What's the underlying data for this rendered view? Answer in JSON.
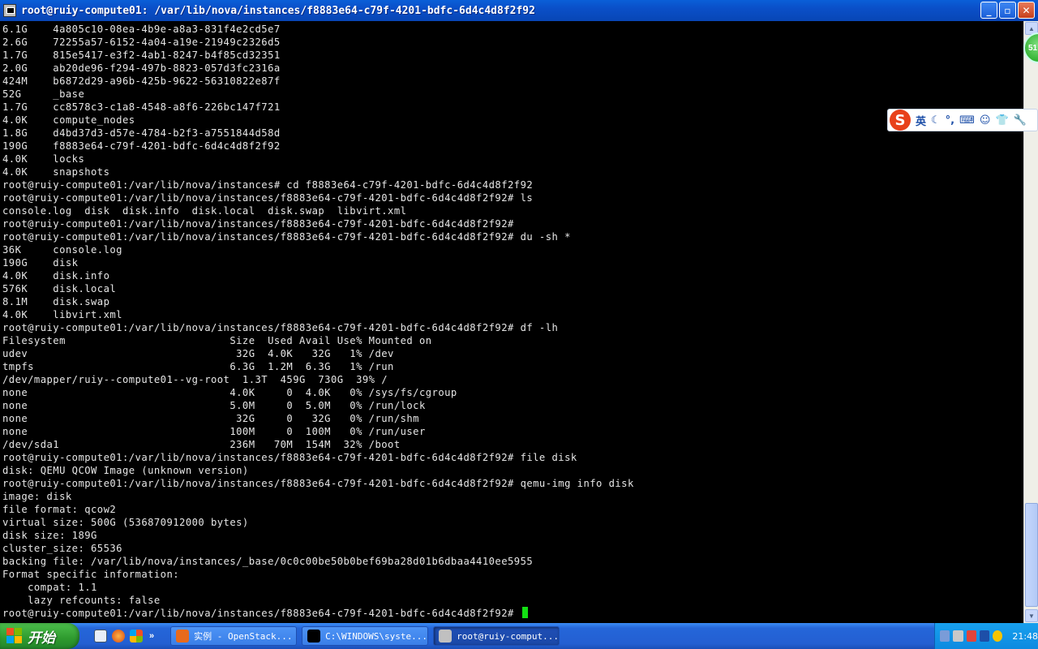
{
  "window": {
    "title": "root@ruiy-compute01: /var/lib/nova/instances/f8883e64-c79f-4201-bdfc-6d4c4d8f2f92",
    "minimize_glyph": "_",
    "maximize_glyph": "▫",
    "close_glyph": "✕"
  },
  "terminal": {
    "lines": [
      "6.1G    4a805c10-08ea-4b9e-a8a3-831f4e2cd5e7",
      "2.6G    72255a57-6152-4a04-a19e-21949c2326d5",
      "1.7G    815e5417-e3f2-4ab1-8247-b4f85cd32351",
      "2.0G    ab20de96-f294-497b-8823-057d3fc2316a",
      "424M    b6872d29-a96b-425b-9622-56310822e87f",
      "52G     _base",
      "1.7G    cc8578c3-c1a8-4548-a8f6-226bc147f721",
      "4.0K    compute_nodes",
      "1.8G    d4bd37d3-d57e-4784-b2f3-a7551844d58d",
      "190G    f8883e64-c79f-4201-bdfc-6d4c4d8f2f92",
      "4.0K    locks",
      "4.0K    snapshots",
      "root@ruiy-compute01:/var/lib/nova/instances# cd f8883e64-c79f-4201-bdfc-6d4c4d8f2f92",
      "root@ruiy-compute01:/var/lib/nova/instances/f8883e64-c79f-4201-bdfc-6d4c4d8f2f92# ls",
      "console.log  disk  disk.info  disk.local  disk.swap  libvirt.xml",
      "root@ruiy-compute01:/var/lib/nova/instances/f8883e64-c79f-4201-bdfc-6d4c4d8f2f92#",
      "root@ruiy-compute01:/var/lib/nova/instances/f8883e64-c79f-4201-bdfc-6d4c4d8f2f92# du -sh *",
      "36K     console.log",
      "190G    disk",
      "4.0K    disk.info",
      "576K    disk.local",
      "8.1M    disk.swap",
      "4.0K    libvirt.xml",
      "root@ruiy-compute01:/var/lib/nova/instances/f8883e64-c79f-4201-bdfc-6d4c4d8f2f92# df -lh",
      "Filesystem                          Size  Used Avail Use% Mounted on",
      "udev                                 32G  4.0K   32G   1% /dev",
      "tmpfs                               6.3G  1.2M  6.3G   1% /run",
      "/dev/mapper/ruiy--compute01--vg-root  1.3T  459G  730G  39% /",
      "none                                4.0K     0  4.0K   0% /sys/fs/cgroup",
      "none                                5.0M     0  5.0M   0% /run/lock",
      "none                                 32G     0   32G   0% /run/shm",
      "none                                100M     0  100M   0% /run/user",
      "/dev/sda1                           236M   70M  154M  32% /boot",
      "root@ruiy-compute01:/var/lib/nova/instances/f8883e64-c79f-4201-bdfc-6d4c4d8f2f92# file disk",
      "disk: QEMU QCOW Image (unknown version)",
      "root@ruiy-compute01:/var/lib/nova/instances/f8883e64-c79f-4201-bdfc-6d4c4d8f2f92# qemu-img info disk",
      "image: disk",
      "file format: qcow2",
      "virtual size: 500G (536870912000 bytes)",
      "disk size: 189G",
      "cluster_size: 65536",
      "backing file: /var/lib/nova/instances/_base/0c0c00be50b0bef69ba28d01b6dbaa4410ee5955",
      "Format specific information:",
      "    compat: 1.1",
      "    lazy refcounts: false",
      "root@ruiy-compute01:/var/lib/nova/instances/f8883e64-c79f-4201-bdfc-6d4c4d8f2f92# "
    ],
    "cursor_color": "#13e013"
  },
  "badge": {
    "text": "51"
  },
  "ime": {
    "logo": "S",
    "mode": "英",
    "items": [
      "☾",
      "°,",
      "⌨",
      "☺",
      "👕",
      "🔧"
    ]
  },
  "taskbar": {
    "start_label": "开始",
    "quicklaunch_more": "»",
    "tasks": [
      {
        "label": "实例 - OpenStack...",
        "icon_color": "#e86a1c",
        "active": false
      },
      {
        "label": "C:\\WINDOWS\\syste...",
        "icon_color": "#000000",
        "active": false
      },
      {
        "label": "root@ruiy-comput...",
        "icon_color": "#c0c0c0",
        "active": true
      }
    ],
    "clock": "21:48"
  }
}
